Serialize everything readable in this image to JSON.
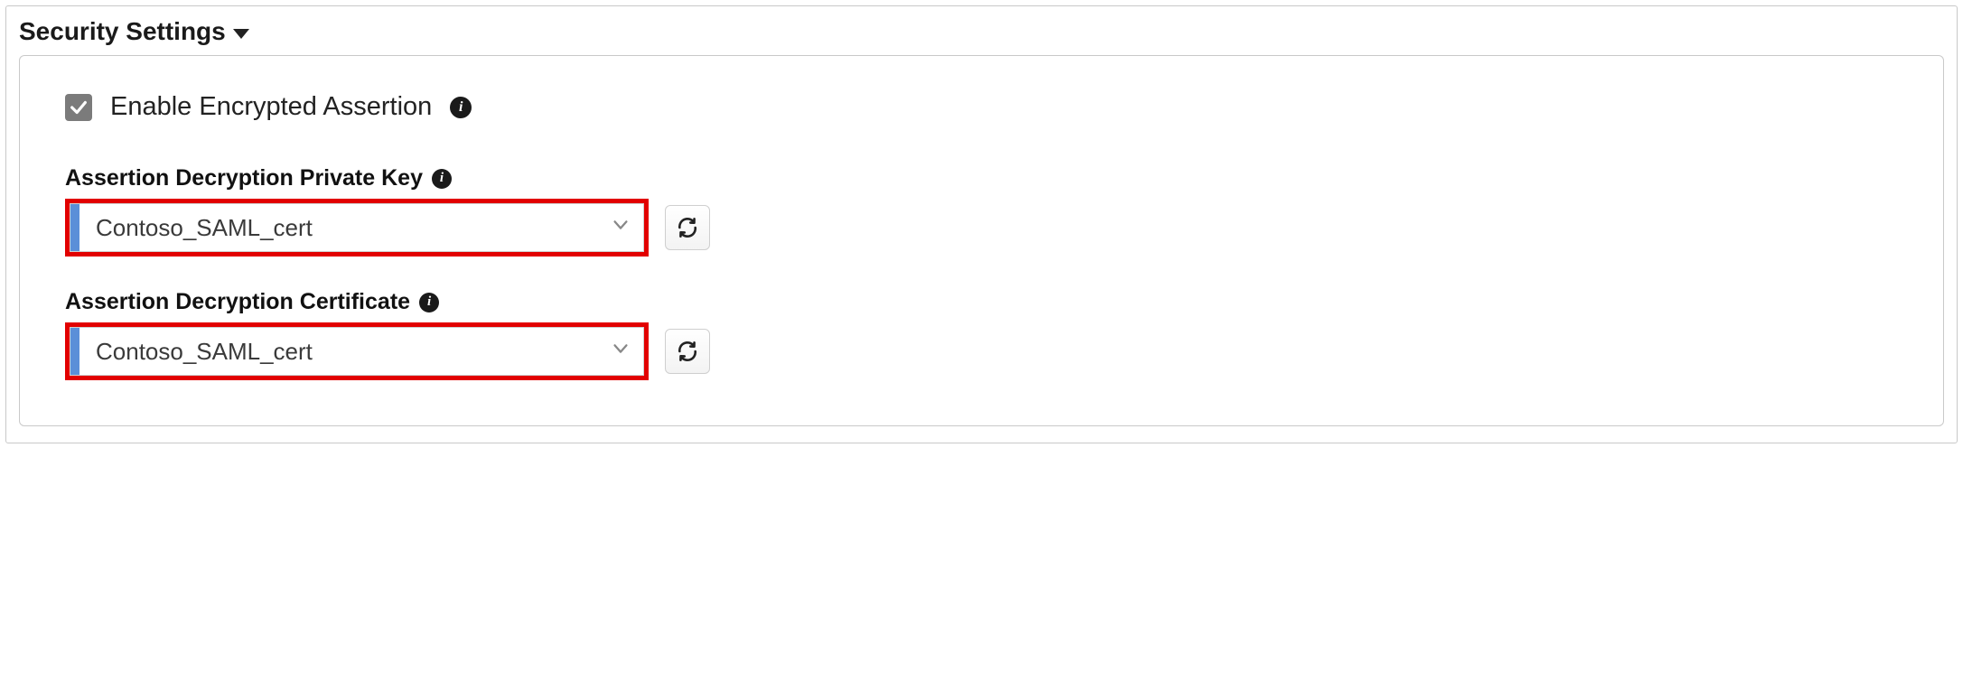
{
  "section": {
    "title": "Security Settings"
  },
  "checkbox": {
    "label": "Enable Encrypted Assertion",
    "checked": true
  },
  "fields": {
    "privateKey": {
      "label": "Assertion Decryption Private Key",
      "value": "Contoso_SAML_cert"
    },
    "certificate": {
      "label": "Assertion Decryption Certificate",
      "value": "Contoso_SAML_cert"
    }
  },
  "icons": {
    "info_glyph": "i"
  },
  "colors": {
    "highlight_border": "#e20000",
    "select_edge": "#5b8fd8",
    "checkbox_bg": "#7b7b7b"
  }
}
